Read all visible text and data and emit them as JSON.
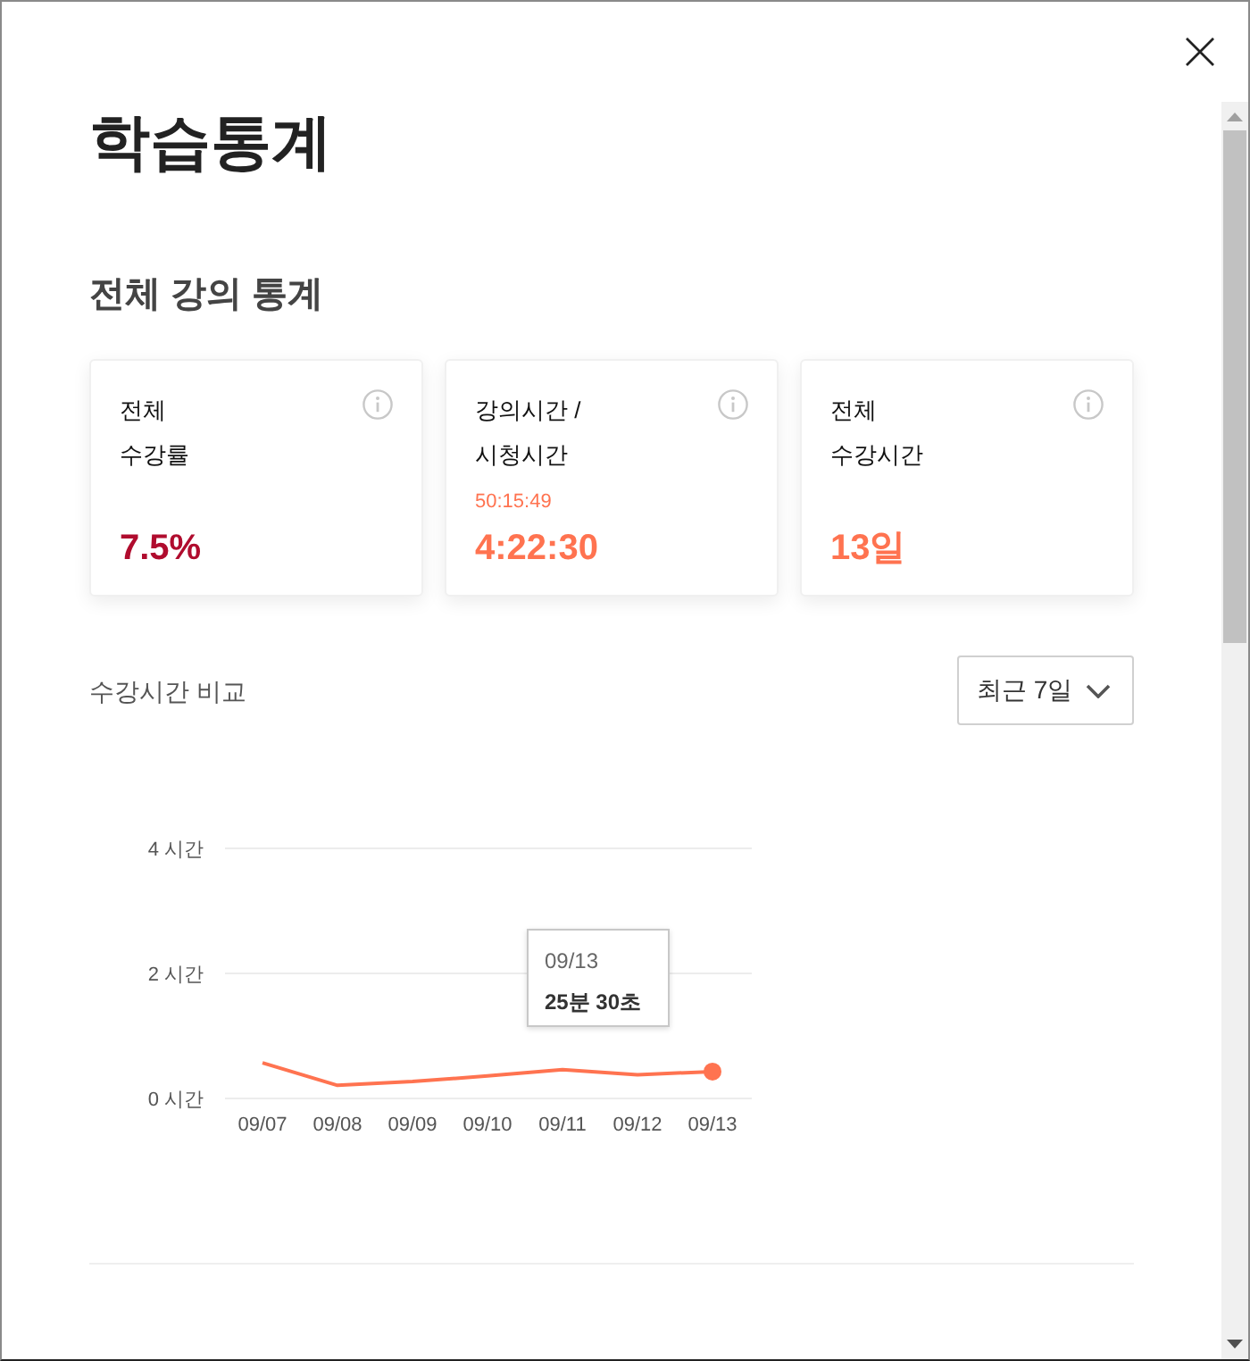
{
  "title": "학습통계",
  "overview": {
    "heading": "전체 강의 통계",
    "cards": [
      {
        "label_lines": [
          "전체",
          "수강률"
        ],
        "value": "7.5%",
        "color": "#b00c2e"
      },
      {
        "label_lines": [
          "강의시간 /",
          "시청시간"
        ],
        "sub_value": "50:15:49",
        "value": "4:22:30",
        "color": "#ff7350"
      },
      {
        "label_lines": [
          "전체",
          "수강시간"
        ],
        "value": "13일",
        "color": "#ff7350"
      }
    ]
  },
  "comparison": {
    "label": "수강시간 비교",
    "period_select": {
      "value": "최근 7일"
    },
    "chart_data": {
      "type": "line",
      "categories": [
        "09/07",
        "09/08",
        "09/09",
        "09/10",
        "09/11",
        "09/12",
        "09/13"
      ],
      "series": [
        {
          "color": "#ff7350",
          "values": [
            0.57,
            0.21,
            0.27,
            0.36,
            0.46,
            0.38,
            0.43
          ]
        }
      ],
      "ylim": [
        0,
        4
      ],
      "yticks": [
        {
          "value": 0,
          "label": "0 시간"
        },
        {
          "value": 2,
          "label": "2 시간"
        },
        {
          "value": 4,
          "label": "4 시간"
        }
      ]
    },
    "tooltip": {
      "date": "09/13",
      "value": "25분 30초"
    }
  }
}
